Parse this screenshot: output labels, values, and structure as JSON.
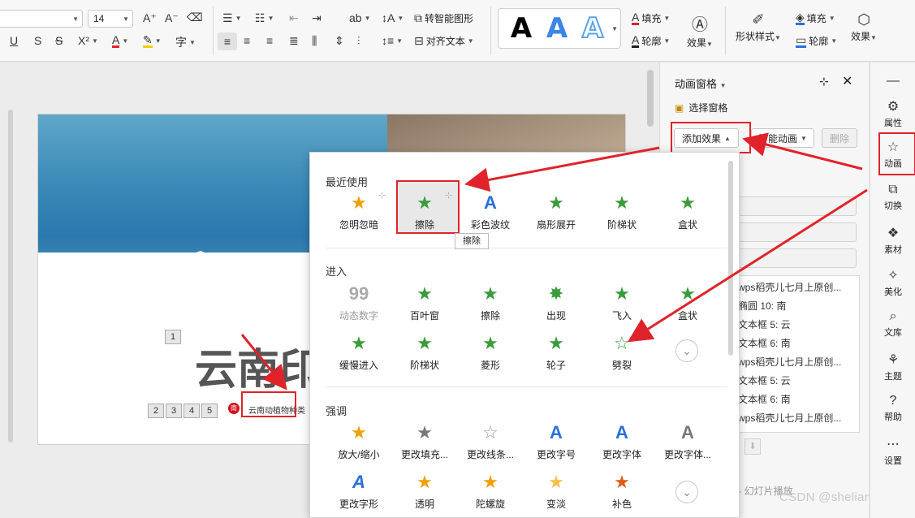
{
  "ribbon": {
    "font_size": "14",
    "convert_smartart": "转智能图形",
    "align_text": "对齐文本",
    "fill": "填充",
    "outline": "轮廓",
    "effect": "效果",
    "shape_style": "形状样式",
    "shape_fill": "填充",
    "shape_outline": "轮廓",
    "shape_effect": "效果",
    "wordart_letter": "A"
  },
  "slide": {
    "title_text": "云南印",
    "tag1": "1",
    "tags": [
      "2",
      "3",
      "4",
      "5"
    ],
    "red_label": "南",
    "subtitle": "云南动植物种类"
  },
  "pane": {
    "title": "动画窗格",
    "select_pane": "选择窗格",
    "add_effect": "添加效果",
    "smart_anim": "智能动画",
    "delete": "删除",
    "items": [
      "wps稻壳儿七月上原创...",
      "椭圆 10: 南",
      "文本框 5: 云",
      "文本框 6: 南",
      "wps稻壳儿七月上原创...",
      "文本框 5: 云",
      "文本框 6: 南",
      "wps稻壳儿七月上原创..."
    ],
    "slideshow": "幻灯片播放"
  },
  "sidebar": [
    {
      "label": "属性",
      "icon": "sliders-icon"
    },
    {
      "label": "动画",
      "icon": "star-icon"
    },
    {
      "label": "切换",
      "icon": "switch-icon"
    },
    {
      "label": "素材",
      "icon": "material-icon"
    },
    {
      "label": "美化",
      "icon": "magic-icon"
    },
    {
      "label": "文库",
      "icon": "library-icon"
    },
    {
      "label": "主题",
      "icon": "theme-icon"
    },
    {
      "label": "帮助",
      "icon": "help-icon"
    },
    {
      "label": "设置",
      "icon": "more-icon"
    }
  ],
  "popup": {
    "recent_title": "最近使用",
    "recent": [
      "忽明忽暗",
      "擦除",
      "彩色波纹",
      "扇形展开",
      "阶梯状",
      "盒状"
    ],
    "enter_title": "进入",
    "enter_row1": [
      "动态数字",
      "百叶窗",
      "擦除",
      "出现",
      "飞入",
      "盒状"
    ],
    "enter_row2": [
      "缓慢进入",
      "阶梯状",
      "菱形",
      "轮子",
      "劈裂"
    ],
    "emph_title": "强调",
    "emph_row1": [
      "放大/缩小",
      "更改填充...",
      "更改线条...",
      "更改字号",
      "更改字体",
      "更改字体..."
    ],
    "emph_row2": [
      "更改字形",
      "透明",
      "陀螺旋",
      "变淡",
      "补色"
    ],
    "tooltip": "擦除",
    "digit_icon": "99"
  },
  "watermark": "CSDN @shelian_",
  "colors": {
    "accent_red": "#e0232a",
    "star_green": "#3b9b3b"
  }
}
